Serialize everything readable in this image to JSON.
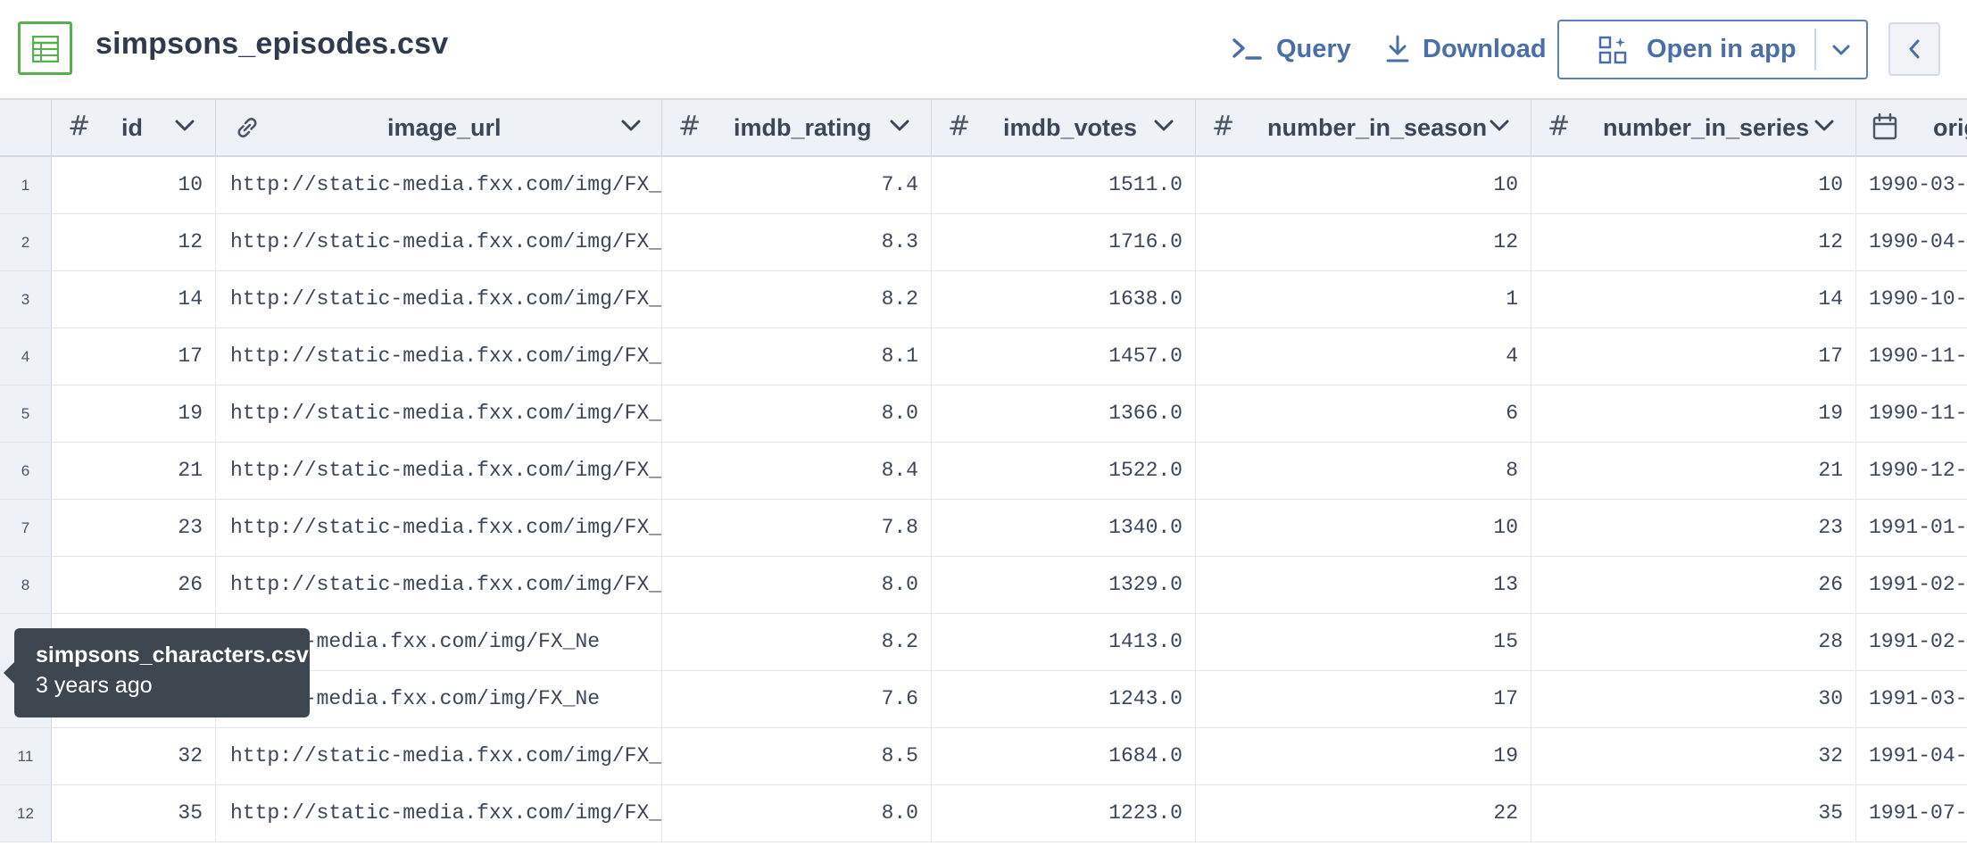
{
  "header": {
    "file_name": "simpsons_episodes.csv",
    "query_label": "Query",
    "download_label": "Download",
    "open_in_app_label": "Open in app"
  },
  "colors": {
    "accent": "#4a6fa8",
    "file_icon_green": "#56b04e",
    "tooltip_bg": "#3e4650"
  },
  "columns": [
    {
      "name": "id",
      "type_icon": "hash-icon"
    },
    {
      "name": "image_url",
      "type_icon": "link-icon"
    },
    {
      "name": "imdb_rating",
      "type_icon": "hash-icon"
    },
    {
      "name": "imdb_votes",
      "type_icon": "hash-icon"
    },
    {
      "name": "number_in_season",
      "type_icon": "hash-icon"
    },
    {
      "name": "number_in_series",
      "type_icon": "hash-icon"
    },
    {
      "name": "orig",
      "type_icon": "calendar-icon"
    }
  ],
  "rows": [
    {
      "n": "1",
      "id": "10",
      "image_url": "http://static-media.fxx.com/img/FX_Ne",
      "imdb_rating": "7.4",
      "imdb_votes": "1511.0",
      "number_in_season": "10",
      "number_in_series": "10",
      "orig": "1990-03-"
    },
    {
      "n": "2",
      "id": "12",
      "image_url": "http://static-media.fxx.com/img/FX_Ne",
      "imdb_rating": "8.3",
      "imdb_votes": "1716.0",
      "number_in_season": "12",
      "number_in_series": "12",
      "orig": "1990-04-"
    },
    {
      "n": "3",
      "id": "14",
      "image_url": "http://static-media.fxx.com/img/FX_Ne",
      "imdb_rating": "8.2",
      "imdb_votes": "1638.0",
      "number_in_season": "1",
      "number_in_series": "14",
      "orig": "1990-10-"
    },
    {
      "n": "4",
      "id": "17",
      "image_url": "http://static-media.fxx.com/img/FX_Ne",
      "imdb_rating": "8.1",
      "imdb_votes": "1457.0",
      "number_in_season": "4",
      "number_in_series": "17",
      "orig": "1990-11-"
    },
    {
      "n": "5",
      "id": "19",
      "image_url": "http://static-media.fxx.com/img/FX_Ne",
      "imdb_rating": "8.0",
      "imdb_votes": "1366.0",
      "number_in_season": "6",
      "number_in_series": "19",
      "orig": "1990-11-"
    },
    {
      "n": "6",
      "id": "21",
      "image_url": "http://static-media.fxx.com/img/FX_Ne",
      "imdb_rating": "8.4",
      "imdb_votes": "1522.0",
      "number_in_season": "8",
      "number_in_series": "21",
      "orig": "1990-12-"
    },
    {
      "n": "7",
      "id": "23",
      "image_url": "http://static-media.fxx.com/img/FX_Ne",
      "imdb_rating": "7.8",
      "imdb_votes": "1340.0",
      "number_in_season": "10",
      "number_in_series": "23",
      "orig": "1991-01-"
    },
    {
      "n": "8",
      "id": "26",
      "image_url": "http://static-media.fxx.com/img/FX_Ne",
      "imdb_rating": "8.0",
      "imdb_votes": "1329.0",
      "number_in_season": "13",
      "number_in_series": "26",
      "orig": "1991-02-"
    },
    {
      "n": "",
      "id": "",
      "image_url": "static-media.fxx.com/img/FX_Ne",
      "imdb_rating": "8.2",
      "imdb_votes": "1413.0",
      "number_in_season": "15",
      "number_in_series": "28",
      "orig": "1991-02-"
    },
    {
      "n": "",
      "id": "",
      "image_url": "static-media.fxx.com/img/FX_Ne",
      "imdb_rating": "7.6",
      "imdb_votes": "1243.0",
      "number_in_season": "17",
      "number_in_series": "30",
      "orig": "1991-03-"
    },
    {
      "n": "11",
      "id": "32",
      "image_url": "http://static-media.fxx.com/img/FX_Ne",
      "imdb_rating": "8.5",
      "imdb_votes": "1684.0",
      "number_in_season": "19",
      "number_in_series": "32",
      "orig": "1991-04-"
    },
    {
      "n": "12",
      "id": "35",
      "image_url": "http://static-media.fxx.com/img/FX_Ne",
      "imdb_rating": "8.0",
      "imdb_votes": "1223.0",
      "number_in_season": "22",
      "number_in_series": "35",
      "orig": "1991-07-"
    }
  ],
  "tooltip": {
    "file_name": "simpsons_characters.csv",
    "time": "3 years ago"
  }
}
